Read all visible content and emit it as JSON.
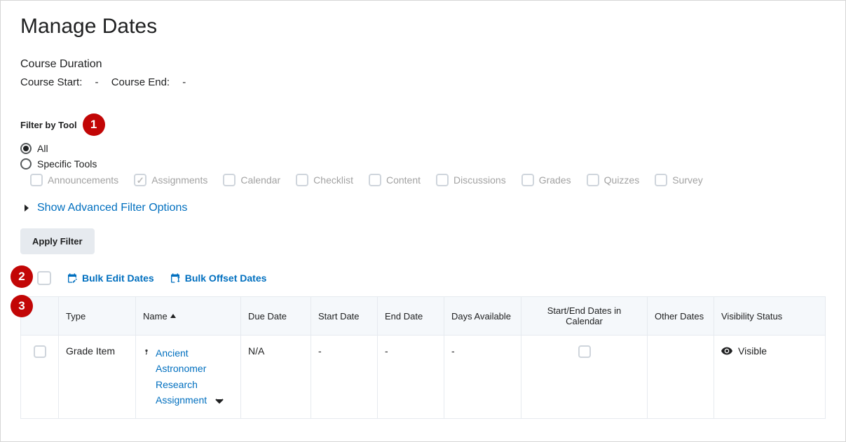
{
  "title": "Manage Dates",
  "course_duration_label": "Course Duration",
  "course_start_label": "Course Start:",
  "course_start_value": "-",
  "course_end_label": "Course End:",
  "course_end_value": "-",
  "filter_label": "Filter by Tool",
  "radios": {
    "all": "All",
    "specific": "Specific Tools"
  },
  "tools": [
    {
      "label": "Announcements",
      "checked": false
    },
    {
      "label": "Assignments",
      "checked": true
    },
    {
      "label": "Calendar",
      "checked": false
    },
    {
      "label": "Checklist",
      "checked": false
    },
    {
      "label": "Content",
      "checked": false
    },
    {
      "label": "Discussions",
      "checked": false
    },
    {
      "label": "Grades",
      "checked": false
    },
    {
      "label": "Quizzes",
      "checked": false
    },
    {
      "label": "Survey",
      "checked": false
    }
  ],
  "advanced_filter_label": "Show Advanced Filter Options",
  "apply_filter_label": "Apply Filter",
  "bulk_edit_label": "Bulk Edit Dates",
  "bulk_offset_label": "Bulk Offset Dates",
  "columns": {
    "type": "Type",
    "name": "Name",
    "due": "Due Date",
    "start": "Start Date",
    "end": "End Date",
    "days": "Days Available",
    "cal": "Start/End Dates in Calendar",
    "other": "Other Dates",
    "vis": "Visibility Status"
  },
  "rows": [
    {
      "type": "Grade Item",
      "name": "Ancient Astronomer Research Assignment",
      "due": "N/A",
      "start": "-",
      "end": "-",
      "days": "-",
      "cal_checked": false,
      "other": "",
      "visibility": "Visible"
    }
  ],
  "callouts": {
    "c1": "1",
    "c2": "2",
    "c3": "3"
  }
}
